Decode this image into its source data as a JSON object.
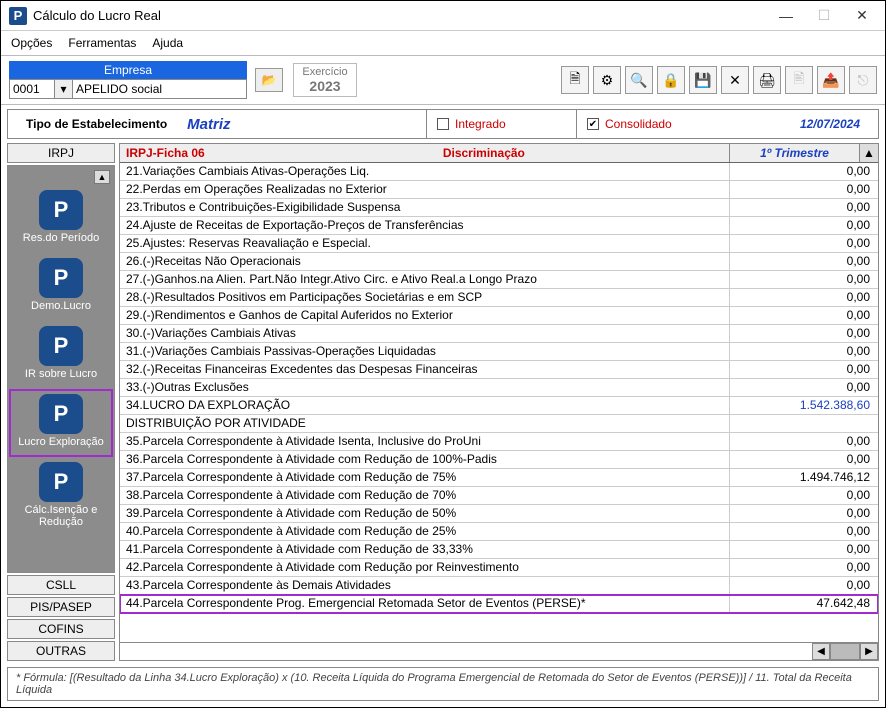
{
  "window": {
    "title": "Cálculo do Lucro Real"
  },
  "menu": {
    "opcoes": "Opções",
    "ferramentas": "Ferramentas",
    "ajuda": "Ajuda"
  },
  "toolbar": {
    "empresa_header": "Empresa",
    "empresa_code": "0001",
    "empresa_apelido": "APELIDO social",
    "exercicio_label": "Exercício",
    "exercicio_year": "2023"
  },
  "infobar": {
    "tipo_label": "Tipo de Estabelecimento",
    "tipo_value": "Matriz",
    "integrado": "Integrado",
    "consolidado": "Consolidado",
    "date": "12/07/2024"
  },
  "sidebar": {
    "tabs_top": {
      "irpj": "IRPJ"
    },
    "items": [
      {
        "label": "Res.do Período"
      },
      {
        "label": "Demo.Lucro"
      },
      {
        "label": "IR sobre Lucro"
      },
      {
        "label": "Lucro Exploração"
      },
      {
        "label": "Cálc.Isenção e Redução"
      }
    ],
    "tabs_bottom": {
      "csll": "CSLL",
      "pispasep": "PIS/PASEP",
      "cofins": "COFINS",
      "outras": "OUTRAS"
    }
  },
  "grid": {
    "ficha": "IRPJ-Ficha  06",
    "disc": "Discriminação",
    "col2": "1º Trimestre",
    "rows": [
      {
        "d": "21.Variações Cambiais Ativas-Operações Liq.",
        "v": "0,00"
      },
      {
        "d": "22.Perdas em Operações Realizadas no Exterior",
        "v": "0,00"
      },
      {
        "d": "23.Tributos e Contribuições-Exigibilidade Suspensa",
        "v": "0,00"
      },
      {
        "d": "24.Ajuste de Receitas de Exportação-Preços de Transferências",
        "v": "0,00"
      },
      {
        "d": "25.Ajustes: Reservas Reavaliação e Especial.",
        "v": "0,00"
      },
      {
        "d": "26.(-)Receitas Não Operacionais",
        "v": "0,00"
      },
      {
        "d": "27.(-)Ganhos.na Alien. Part.Não Integr.Ativo Circ. e Ativo Real.a Longo Prazo",
        "v": "0,00"
      },
      {
        "d": "28.(-)Resultados Positivos em Participações Societárias e em SCP",
        "v": "0,00"
      },
      {
        "d": "29.(-)Rendimentos e Ganhos de Capital Auferidos no Exterior",
        "v": "0,00"
      },
      {
        "d": "30.(-)Variações Cambiais Ativas",
        "v": "0,00"
      },
      {
        "d": "31.(-)Variações Cambiais Passivas-Operações Liquidadas",
        "v": "0,00"
      },
      {
        "d": "32.(-)Receitas Financeiras Excedentes das Despesas Financeiras",
        "v": "0,00"
      },
      {
        "d": "33.(-)Outras Exclusões",
        "v": "0,00"
      },
      {
        "d": "34.LUCRO DA EXPLORAÇÃO",
        "v": "1.542.388,60",
        "lucro": true
      },
      {
        "d": "DISTRIBUIÇÃO POR ATIVIDADE",
        "v": ""
      },
      {
        "d": "35.Parcela Correspondente à Atividade Isenta, Inclusive do ProUni",
        "v": "0,00"
      },
      {
        "d": "36.Parcela Correspondente à Atividade com Redução de 100%-Padis",
        "v": "0,00"
      },
      {
        "d": "37.Parcela Correspondente à Atividade com Redução de 75%",
        "v": "1.494.746,12"
      },
      {
        "d": "38.Parcela Correspondente à Atividade com Redução de 70%",
        "v": "0,00"
      },
      {
        "d": "39.Parcela Correspondente à Atividade com Redução de 50%",
        "v": "0,00"
      },
      {
        "d": "40.Parcela Correspondente à Atividade com Redução de 25%",
        "v": "0,00"
      },
      {
        "d": "41.Parcela Correspondente à Atividade com Redução de 33,33%",
        "v": "0,00"
      },
      {
        "d": "42.Parcela Correspondente à Atividade com Redução por Reinvestimento",
        "v": "0,00"
      },
      {
        "d": "43.Parcela Correspondente às Demais Atividades",
        "v": "0,00"
      },
      {
        "d": "44.Parcela Correspondente Prog. Emergencial Retomada Setor de Eventos (PERSE)*",
        "v": "47.642,48",
        "hl": true
      }
    ]
  },
  "footer": {
    "text": "* Fórmula: [(Resultado da Linha 34.Lucro Exploração) x (10. Receita Líquida do Programa Emergencial de Retomada do Setor de Eventos (PERSE))] / 11. Total da Receita Líquida"
  }
}
